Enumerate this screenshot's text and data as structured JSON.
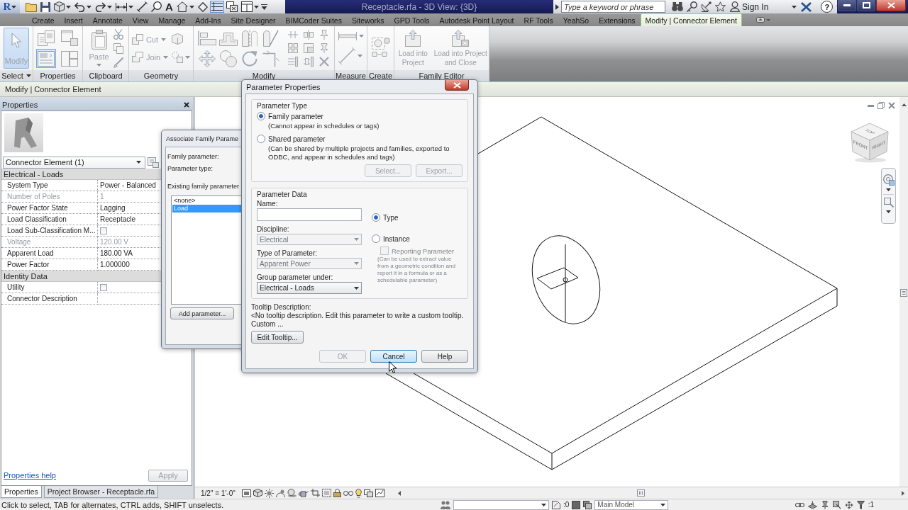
{
  "app_button": {
    "label": "R"
  },
  "quick_access": [
    {
      "selected": false,
      "dropdown": false
    },
    {
      "selected": false,
      "dropdown": false
    },
    {
      "selected": false,
      "dropdown": true
    },
    {
      "selected": false,
      "dropdown": true
    },
    {
      "selected": false,
      "dropdown": true
    },
    {
      "selected": false,
      "dropdown": true
    },
    {
      "selected": false,
      "dropdown": false
    },
    {
      "selected": false,
      "dropdown": false
    },
    {
      "label": "A",
      "selected": false,
      "dropdown": false
    },
    {
      "selected": false,
      "dropdown": true
    },
    {
      "selected": false,
      "dropdown": false
    },
    {
      "selected": true,
      "dropdown": false
    },
    {
      "selected": false,
      "dropdown": false
    },
    {
      "selected": false,
      "dropdown": true
    }
  ],
  "window": {
    "title": "Receptacle.rfa - 3D View: {3D}"
  },
  "search": {
    "placeholder": "Type a keyword or phrase"
  },
  "account": {
    "label": "Sign In"
  },
  "help": {
    "label": "?"
  },
  "ribbon_tabs": [
    {
      "label": "Create",
      "selected": false
    },
    {
      "label": "Insert",
      "selected": false
    },
    {
      "label": "Annotate",
      "selected": false
    },
    {
      "label": "View",
      "selected": false
    },
    {
      "label": "Manage",
      "selected": false
    },
    {
      "label": "Add-Ins",
      "selected": false
    },
    {
      "label": "Site Designer",
      "selected": false
    },
    {
      "label": "BIMCoder Suites",
      "selected": false
    },
    {
      "label": "Siteworks",
      "selected": false
    },
    {
      "label": "GPD Tools",
      "selected": false
    },
    {
      "label": "Autodesk Point Layout",
      "selected": false
    },
    {
      "label": "RF Tools",
      "selected": false
    },
    {
      "label": "YeahSo",
      "selected": false
    },
    {
      "label": "Extensions",
      "selected": false
    },
    {
      "label": "Modify | Connector Element",
      "selected": true
    }
  ],
  "ribbon": {
    "select": {
      "title": "Select",
      "dropdown": true,
      "button": {
        "label": "Modify",
        "selected": true,
        "disabled": true
      }
    },
    "properties": {
      "title": "Properties",
      "tools": [
        {
          "selected": false
        },
        {
          "selected": false
        },
        {
          "selected": true
        },
        {
          "selected": false
        }
      ]
    },
    "clipboard": {
      "title": "Clipboard",
      "paste": {
        "label": "Paste",
        "disabled": true
      }
    },
    "geometry": {
      "title": "Geometry",
      "tools": [
        {
          "label": "Cut",
          "disabled": true
        },
        {
          "label": "Join",
          "disabled": true
        }
      ]
    },
    "modify": {
      "title": "Modify"
    },
    "measure": {
      "title": "Measure"
    },
    "create": {
      "title": "Create"
    },
    "family_editor": {
      "title": "Family Editor",
      "buttons": [
        {
          "label": "Load into Project",
          "disabled": true
        },
        {
          "label": "Load into Project and Close",
          "disabled": true
        }
      ]
    }
  },
  "options_bar": {
    "label": "Modify | Connector Element"
  },
  "properties": {
    "title": "Properties",
    "type_selector": "Connector Element (1)",
    "groups": [
      {
        "name": "Electrical - Loads",
        "rows": [
          {
            "kind": "text",
            "name": "System Type",
            "value": "Power - Balanced",
            "disabled": false
          },
          {
            "kind": "text",
            "name": "Number of Poles",
            "value": "1",
            "disabled": true
          },
          {
            "kind": "text",
            "name": "Power Factor State",
            "value": "Lagging",
            "disabled": false
          },
          {
            "kind": "text",
            "name": "Load Classification",
            "value": "Receptacle",
            "disabled": false
          },
          {
            "kind": "checkbox",
            "name": "Load Sub-Classification M...",
            "checked": false,
            "disabled": false
          },
          {
            "kind": "text",
            "name": "Voltage",
            "value": "120.00 V",
            "disabled": true
          },
          {
            "kind": "text",
            "name": "Apparent Load",
            "value": "180.00 VA",
            "disabled": false
          },
          {
            "kind": "text",
            "name": "Power Factor",
            "value": "1.000000",
            "disabled": false
          }
        ]
      },
      {
        "name": "Identity Data",
        "rows": [
          {
            "kind": "checkbox",
            "name": "Utility",
            "checked": false,
            "disabled": false
          },
          {
            "kind": "text",
            "name": "Connector Description",
            "disabled": false
          }
        ]
      }
    ],
    "help_link": "Properties help",
    "apply": {
      "label": "Apply",
      "disabled": true
    }
  },
  "palette_tabs": [
    {
      "label": "Properties",
      "selected": true
    },
    {
      "label": "Project Browser - Receptacle.rfa",
      "selected": false
    }
  ],
  "viewport": {
    "view_cube": {
      "top": "TOP",
      "front": "FRONT",
      "right": "RIGHT"
    }
  },
  "view_bar": {
    "scale": "1/2\" = 1'-0\""
  },
  "status_bar": {
    "message": "Click to select, TAB for alternates, CTRL adds, SHIFT unselects.",
    "editing_count": ":0",
    "model_dropdown": "Main Model",
    "filter_count": ":1"
  },
  "associate_dialog": {
    "title": "Associate Family Parame",
    "family_parameter_label": "Family parameter:",
    "parameter_type_label": "Parameter type:",
    "existing_label": "Existing family parameter",
    "parameters": [
      {
        "label": "<none>",
        "selected": false
      },
      {
        "label": "Load",
        "selected": true
      }
    ],
    "add_button": "Add parameter..."
  },
  "parameter_dialog": {
    "title": "Parameter Properties",
    "type_group": "Parameter Type",
    "type_options": [
      {
        "label": "Family parameter",
        "note": "(Cannot appear in schedules or tags)",
        "selected": true
      },
      {
        "label": "Shared parameter",
        "note": "(Can be shared by multiple projects and families, exported to ODBC, and appear in schedules and tags)",
        "selected": false
      }
    ],
    "shared_buttons": [
      {
        "label": "Select...",
        "disabled": true
      },
      {
        "label": "Export...",
        "disabled": true
      }
    ],
    "data_group": "Parameter Data",
    "name_label": "Name:",
    "fields": [
      {
        "label": "Discipline:",
        "value": "Electrical",
        "disabled": true
      },
      {
        "label": "Type of Parameter:",
        "value": "Apparent Power",
        "disabled": true
      },
      {
        "label": "Group parameter under:",
        "value": "Electrical - Loads",
        "disabled": false
      }
    ],
    "scope_options": [
      {
        "label": "Type",
        "selected": true
      },
      {
        "label": "Instance",
        "selected": false
      }
    ],
    "reporting": {
      "label": "Reporting Parameter",
      "checked": false,
      "disabled": true
    },
    "reporting_note": "(Can be used to extract value from a geometric condition and report it in a formula or as a schedulable parameter)",
    "tooltip_label": "Tooltip Description:",
    "tooltip_text": "<No tooltip description. Edit this parameter to write a custom tooltip. Custom ...",
    "edit_tooltip": "Edit Tooltip...",
    "buttons": [
      {
        "label": "OK",
        "disabled": true,
        "hovered": false
      },
      {
        "label": "Cancel",
        "disabled": false,
        "hovered": true
      },
      {
        "label": "Help",
        "disabled": false,
        "hovered": false
      }
    ]
  }
}
